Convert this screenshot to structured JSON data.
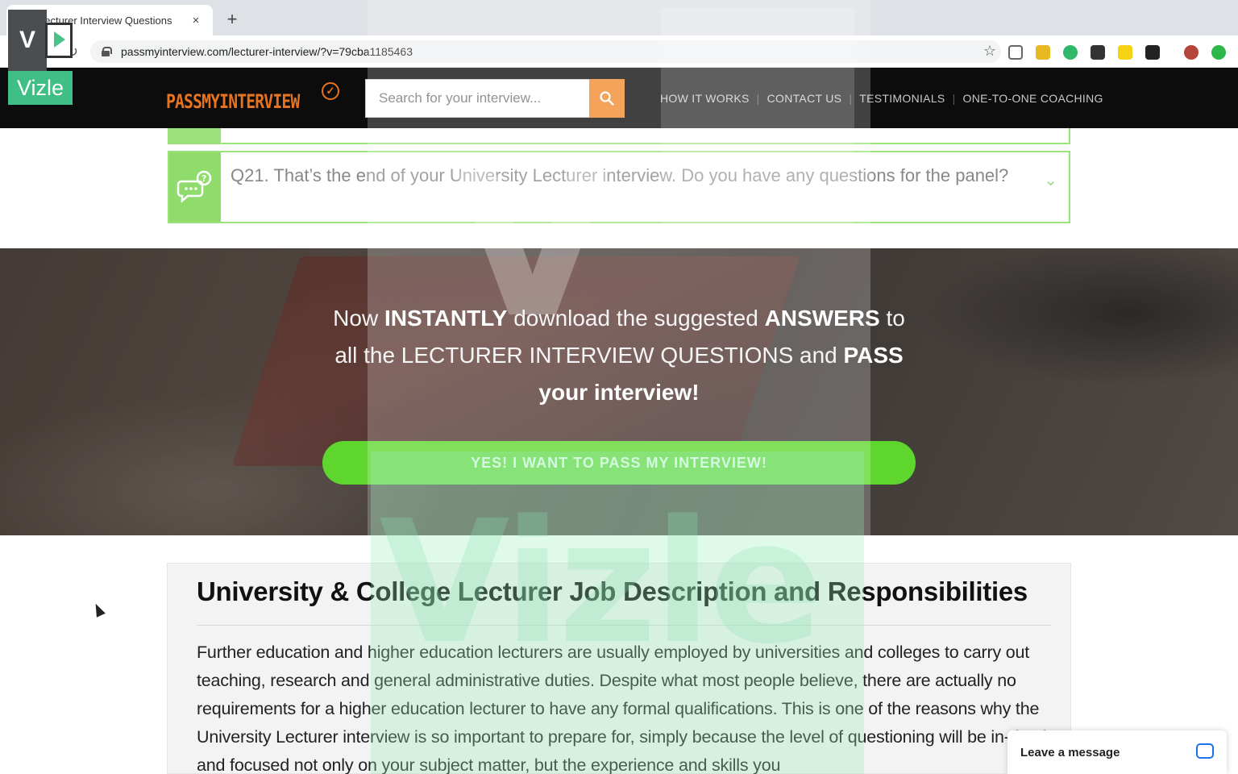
{
  "browser": {
    "tab_title": "Lecturer Interview Questions",
    "tab_close": "×",
    "new_tab": "+",
    "url": "passmyinterview.com/lecturer-interview/?v=79cba1185463"
  },
  "site": {
    "logo": "PASSMYINTERVIEW",
    "search_placeholder": "Search for your interview...",
    "nav": [
      "HOW IT WORKS",
      "CONTACT US",
      "TESTIMONIALS",
      "ONE-TO-ONE COACHING"
    ],
    "brand_color": "#e8731e",
    "accent_green": "#5fd62e"
  },
  "faq": {
    "q21": "Q21. That’s the end of your University Lecturer interview. Do you have any questions for the panel?"
  },
  "hero": {
    "t1": "Now ",
    "t2": "INSTANTLY",
    "t3": " download the suggested ",
    "t4": "ANSWERS",
    "t5": " to all the LECTURER INTERVIEW QUESTIONS and ",
    "t6": "PASS",
    "t7": "your interview!",
    "cta": "YES! I WANT TO PASS MY INTERVIEW!"
  },
  "content": {
    "title": "University & College Lecturer Job Description and Responsibilities",
    "body": "Further education and higher education lecturers are usually employed by universities and colleges to carry out teaching, research and general administrative duties. Despite what most people believe, there are actually no requirements for a higher education lecturer to have any formal qualifications. This is one of the reasons why the University Lecturer interview is so important to prepare for, simply because the level of questioning will be in-depth and focused not only on your subject matter, but the experience and skills you"
  },
  "chat": {
    "label": "Leave a message"
  },
  "watermark": {
    "badge_top": "V",
    "badge_bottom": "Vizle",
    "big_text": "Vizle",
    "big_v": "V"
  }
}
